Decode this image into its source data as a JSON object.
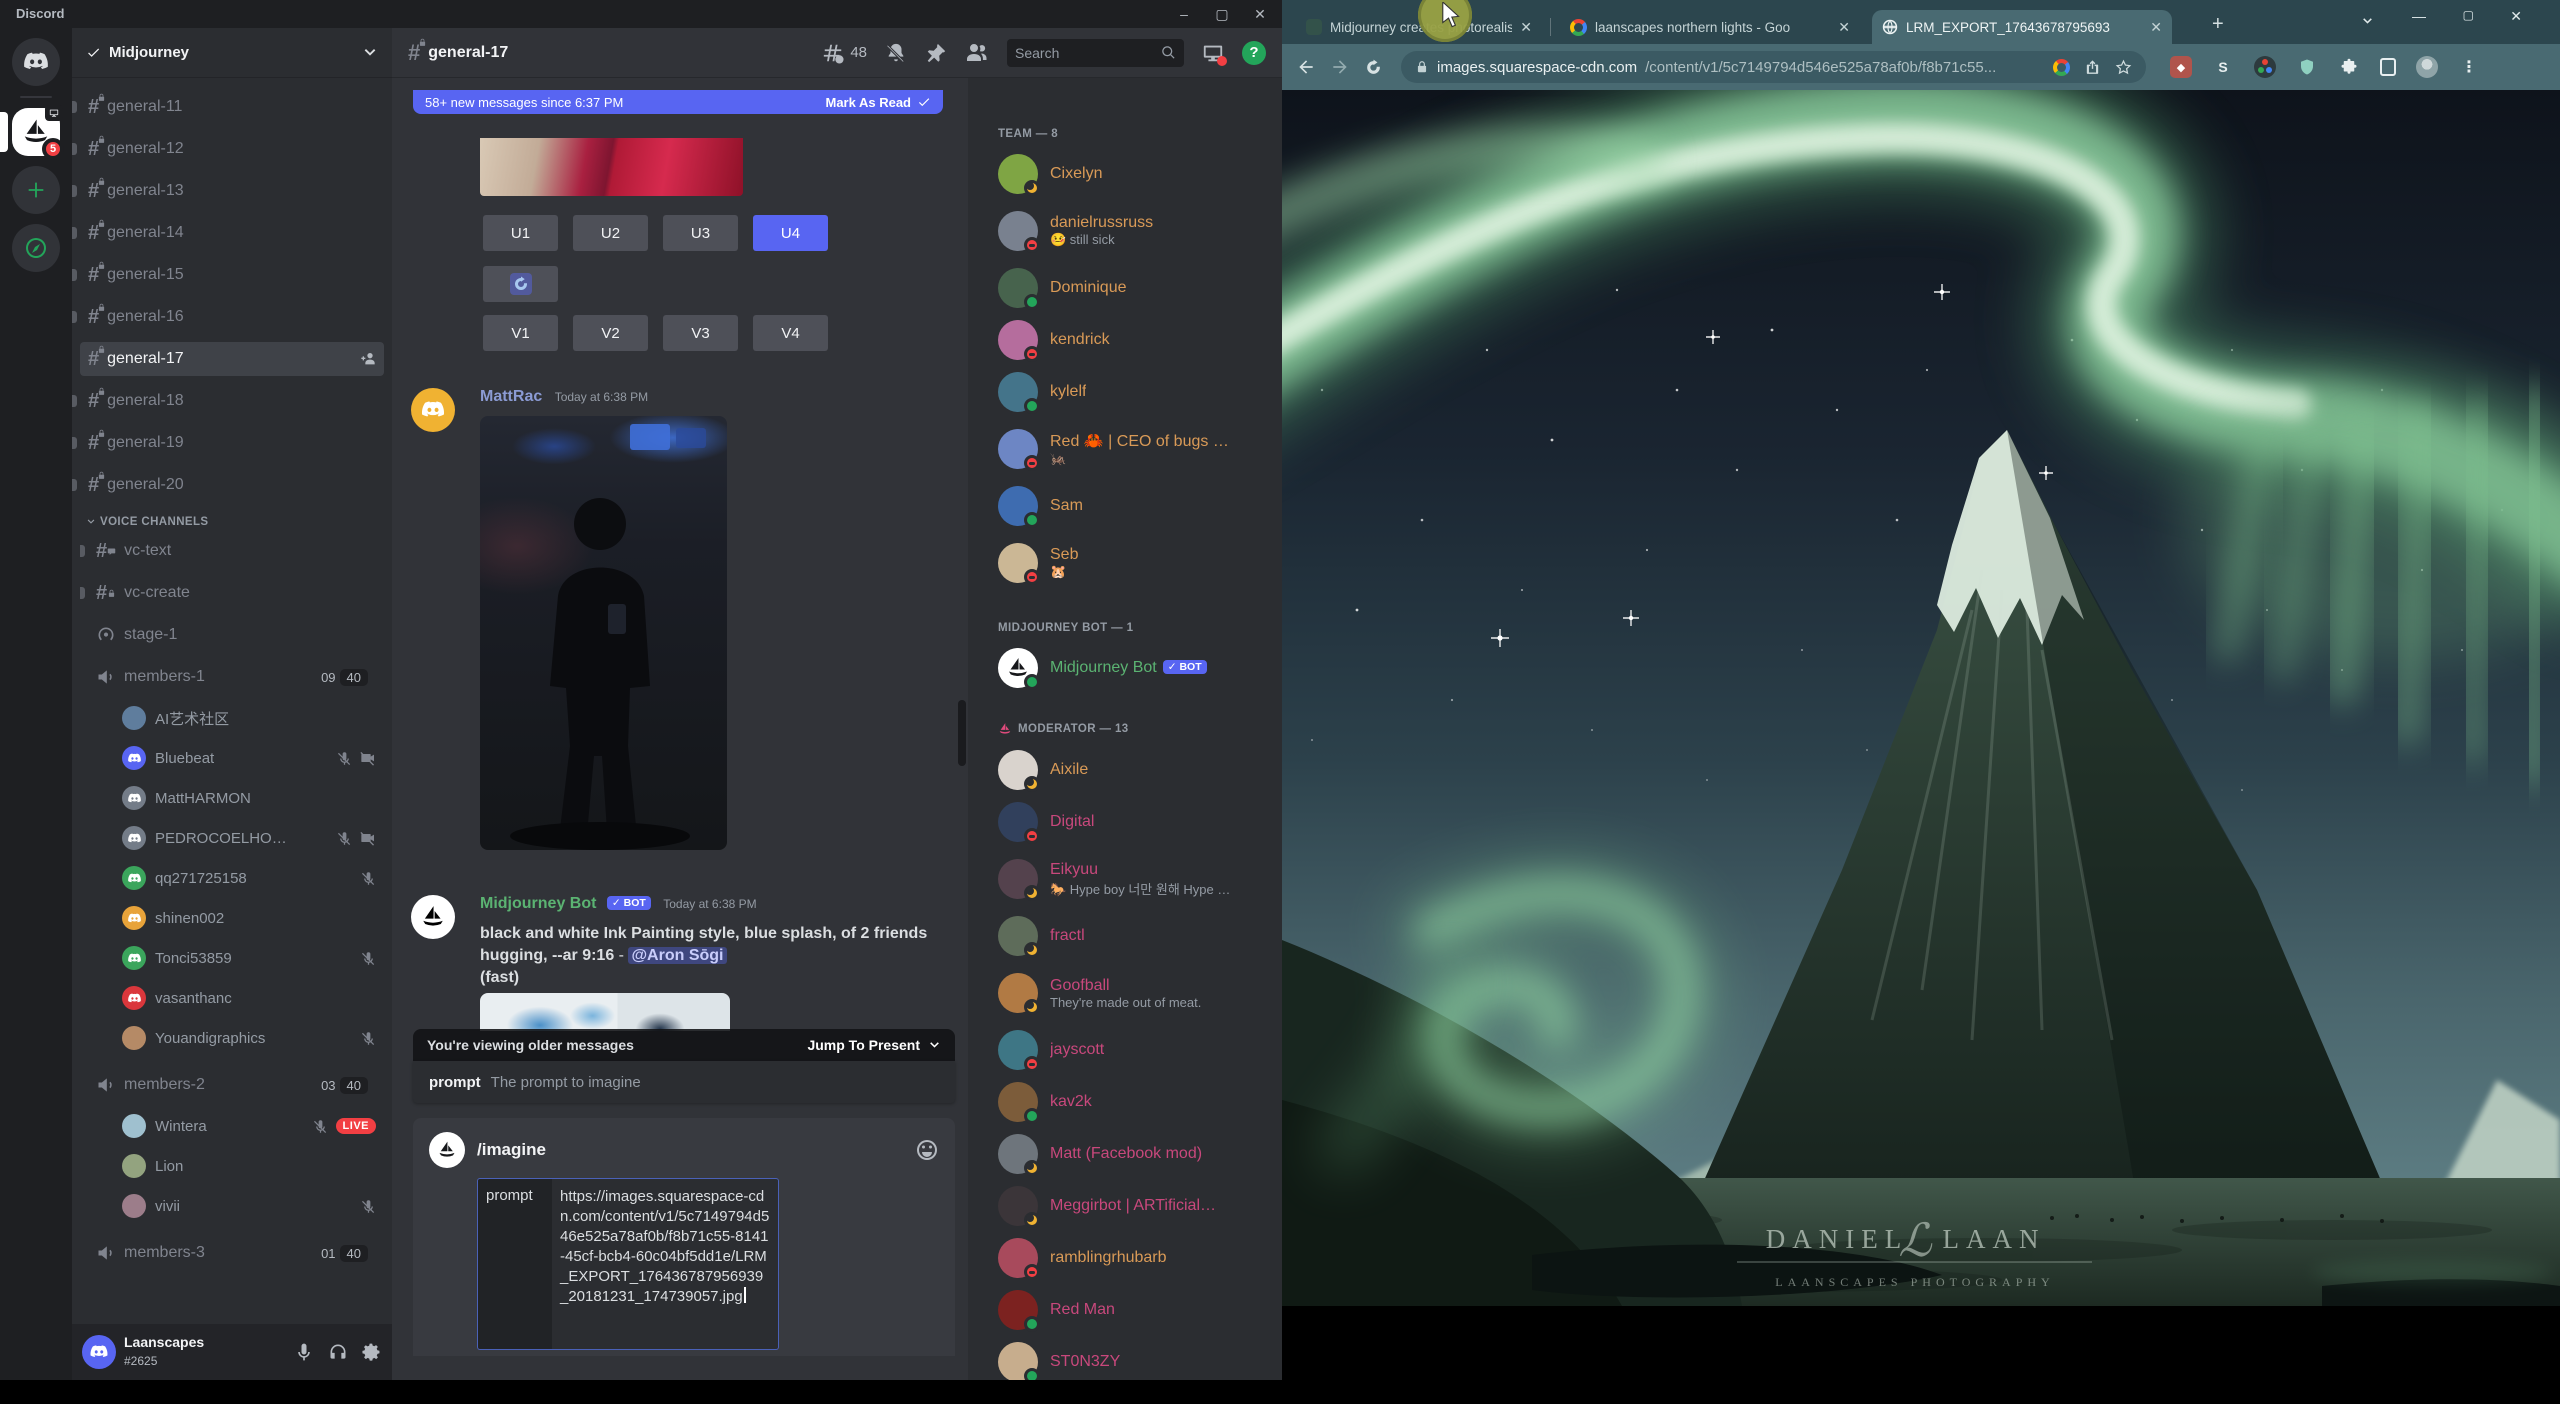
{
  "discord": {
    "titlebar": {
      "title": "Discord"
    },
    "rail": {
      "server_name": "Midjourney",
      "mention_badge": "5"
    },
    "sidebar": {
      "server_name": "Midjourney",
      "channels": [
        {
          "label": "general-11"
        },
        {
          "label": "general-12"
        },
        {
          "label": "general-13"
        },
        {
          "label": "general-14"
        },
        {
          "label": "general-15"
        },
        {
          "label": "general-16"
        },
        {
          "label": "general-17"
        },
        {
          "label": "general-18"
        },
        {
          "label": "general-19"
        },
        {
          "label": "general-20"
        }
      ],
      "voice_header": "VOICE CHANNELS",
      "voice_channels": [
        {
          "label": "vc-text"
        },
        {
          "label": "vc-create"
        },
        {
          "label": "stage-1"
        }
      ],
      "rooms": [
        {
          "label": "members-1",
          "current": "09",
          "max": "40",
          "users": [
            {
              "name": "AI艺术社区"
            },
            {
              "name": "Bluebeat"
            },
            {
              "name": "MattHARMON"
            },
            {
              "name": "PEDROCOELHO…"
            },
            {
              "name": "qq271725158"
            },
            {
              "name": "shinen002"
            },
            {
              "name": "Tonci53859"
            },
            {
              "name": "vasanthanc"
            },
            {
              "name": "Youandigraphics"
            }
          ]
        },
        {
          "label": "members-2",
          "current": "03",
          "max": "40",
          "users": [
            {
              "name": "Wintera",
              "live": "LIVE"
            },
            {
              "name": "Lion"
            },
            {
              "name": "vivii"
            }
          ]
        },
        {
          "label": "members-3",
          "current": "01",
          "max": "40",
          "users": []
        }
      ],
      "user_panel": {
        "name": "Laanscapes",
        "tag": "#2625"
      }
    },
    "chat": {
      "channel": "general-17",
      "threads_count": "48",
      "search_placeholder": "Search",
      "new_bar": {
        "text": "58+ new messages since 6:37 PM",
        "action": "Mark As Read"
      },
      "upscale_buttons": [
        "U1",
        "U2",
        "U3",
        "U4"
      ],
      "variation_buttons": [
        "V1",
        "V2",
        "V3",
        "V4"
      ],
      "messages": {
        "mattrac": {
          "author": "MattRac",
          "time": "Today at 6:38 PM"
        },
        "bot": {
          "author": "Midjourney Bot",
          "badge": "BOT",
          "time": "Today at 6:38 PM",
          "prompt": "black and white Ink Painting style, blue splash, of 2 friends hugging, --ar 9:16",
          "separator": " - ",
          "mention": "@Aron Sōgi",
          "suffix": "(fast)"
        }
      },
      "older_bar": {
        "text": "You're viewing older messages",
        "action": "Jump To Present"
      },
      "autocomplete": {
        "option": "prompt",
        "description": "The prompt to imagine"
      },
      "input": {
        "command": "/imagine",
        "option": "prompt",
        "value": "https://images.squarespace-cdn.com/content/v1/5c7149794d546e525a78af0b/f8b71c55-8141-45cf-bcb4-60c04bf5dd1e/LRM_EXPORT_176436787956939_20181231_174739057.jpg"
      }
    },
    "members": {
      "groups": [
        {
          "label": "TEAM — 8",
          "items": [
            {
              "name": "Cixelyn",
              "status": "idle"
            },
            {
              "name": "danielrussruss",
              "status": "dnd",
              "about": "🤒 still sick"
            },
            {
              "name": "Dominique",
              "status": "online"
            },
            {
              "name": "kendrick",
              "status": "dnd"
            },
            {
              "name": "kylelf",
              "status": "online"
            },
            {
              "name": "Red 🦀 | CEO of bugs …",
              "status": "dnd",
              "about": "🦗"
            },
            {
              "name": "Sam",
              "status": "online"
            },
            {
              "name": "Seb",
              "status": "dnd",
              "about": "🐹"
            }
          ]
        },
        {
          "label": "MIDJOURNEY BOT — 1",
          "items": [
            {
              "name": "Midjourney Bot",
              "status": "online",
              "badge": "BOT"
            }
          ]
        },
        {
          "label": "MODERATOR — 13",
          "items": [
            {
              "name": "Aixile",
              "status": "idle"
            },
            {
              "name": "Digital",
              "status": "dnd"
            },
            {
              "name": "Eikyuu",
              "status": "idle",
              "about": "🐎 Hype boy 너만 원해 Hype …"
            },
            {
              "name": "fractl",
              "status": "idle"
            },
            {
              "name": "Goofball",
              "status": "idle",
              "about": "They're made out of meat."
            },
            {
              "name": "jayscott",
              "status": "dnd"
            },
            {
              "name": "kav2k",
              "status": "online"
            },
            {
              "name": "Matt (Facebook mod)",
              "status": "idle"
            },
            {
              "name": "Meggirbot | ARTificial…",
              "status": "idle"
            },
            {
              "name": "ramblingrhubarb",
              "status": "dnd"
            },
            {
              "name": "Red Man",
              "status": "online"
            },
            {
              "name": "ST0N3ZY",
              "status": "online"
            }
          ]
        }
      ]
    },
    "colors": {
      "accent": "#5865f2",
      "online": "#23a55a",
      "idle": "#f0b232",
      "dnd": "#f23f43",
      "team_role": "#d99a57",
      "mod_role": "#c8487c",
      "bot_role": "#5bb372"
    }
  },
  "chrome": {
    "tabs": [
      {
        "title": "Midjourney creates photorealisti"
      },
      {
        "title": "laanscapes northern lights - Goo"
      },
      {
        "title": "LRM_EXPORT_17643678795693"
      }
    ],
    "url": {
      "domain": "images.squarespace-cdn.com",
      "path": "/content/v1/5c7149794d546e525a78af0b/f8b71c55..."
    },
    "watermark": {
      "name_left": "DANIEL",
      "monogram": "ℒ",
      "name_right": "LAAN",
      "subtitle": "LAANSCAPES PHOTOGRAPHY"
    }
  }
}
